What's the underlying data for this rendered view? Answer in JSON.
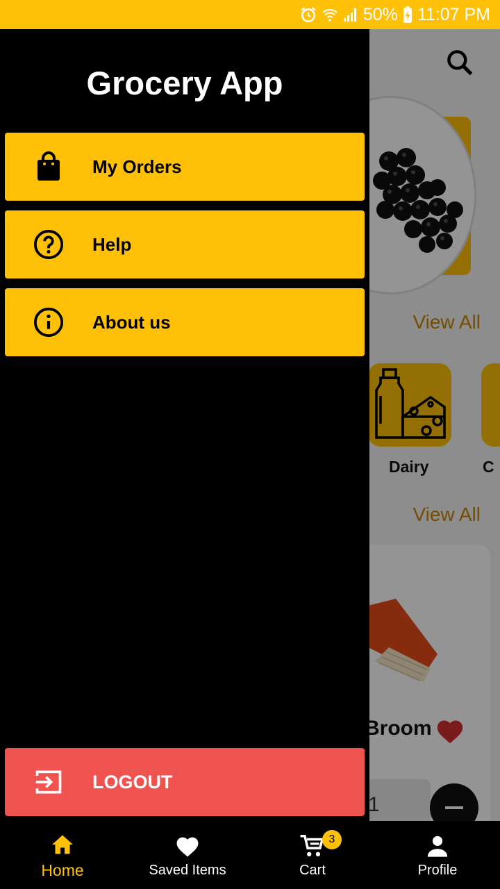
{
  "status_bar": {
    "battery": "50%",
    "time": "11:07 PM",
    "icons": [
      "alarm-icon",
      "wifi-icon",
      "signal-icon",
      "battery-charging-icon"
    ]
  },
  "drawer": {
    "title": "Grocery App",
    "items": [
      {
        "label": "My Orders",
        "icon": "shopping-bag-icon"
      },
      {
        "label": "Help",
        "icon": "help-circle-icon"
      },
      {
        "label": "About us",
        "icon": "info-circle-icon"
      }
    ],
    "logout": {
      "label": "LOGOUT",
      "icon": "logout-icon"
    }
  },
  "background": {
    "view_all_1": "View All",
    "view_all_2": "View All",
    "category_label": "Dairy",
    "category_label_2": "C",
    "product_name": "Broom",
    "quantity": "1"
  },
  "bottom_nav": {
    "items": [
      {
        "label": "Home",
        "icon": "home-icon",
        "active": true
      },
      {
        "label": "Saved Items",
        "icon": "heart-icon"
      },
      {
        "label": "Cart",
        "icon": "cart-icon",
        "badge": "3"
      },
      {
        "label": "Profile",
        "icon": "person-icon"
      }
    ]
  },
  "colors": {
    "accent": "#ffc107",
    "logout": "#ef5350",
    "drawer_bg": "#000000",
    "view_all": "#c8860a"
  }
}
